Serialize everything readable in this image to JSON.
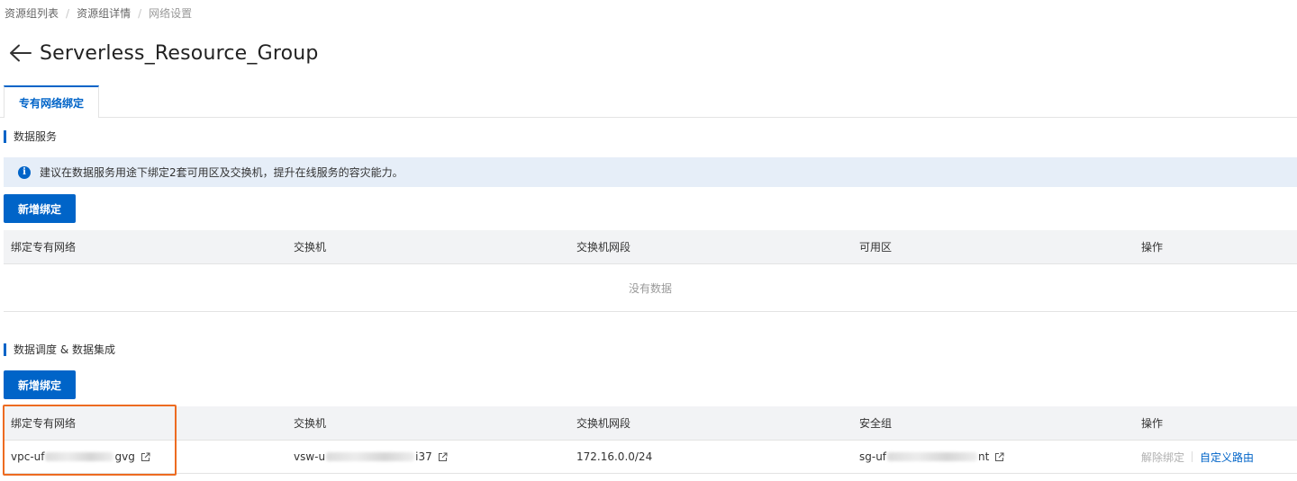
{
  "breadcrumb": [
    "资源组列表",
    "资源组详情",
    "网络设置"
  ],
  "page": {
    "title": "Serverless_Resource_Group"
  },
  "tabs": [
    {
      "label": "专有网络绑定",
      "active": true
    }
  ],
  "data_service": {
    "section_title": "数据服务",
    "notice": "建议在数据服务用途下绑定2套可用区及交换机，提升在线服务的容灾能力。",
    "add_button": "新增绑定",
    "columns": [
      "绑定专有网络",
      "交换机",
      "交换机网段",
      "可用区",
      "操作"
    ],
    "empty_text": "没有数据"
  },
  "scheduling": {
    "section_title": "数据调度 & 数据集成",
    "add_button": "新增绑定",
    "columns": [
      "绑定专有网络",
      "交换机",
      "交换机网段",
      "安全组",
      "操作"
    ],
    "rows": [
      {
        "vpc_prefix": "vpc-uf",
        "vpc_suffix": "gvg",
        "vswitch_prefix": "vsw-u",
        "vswitch_suffix": "i37",
        "cidr": "172.16.0.0/24",
        "sg_prefix": "sg-uf",
        "sg_suffix": "nt",
        "actions": {
          "unbind": "解除绑定",
          "custom_route": "自定义路由"
        }
      }
    ]
  },
  "colors": {
    "primary": "#0064c8",
    "highlight": "#ed6b21",
    "notice_bg": "#e6eef8"
  }
}
